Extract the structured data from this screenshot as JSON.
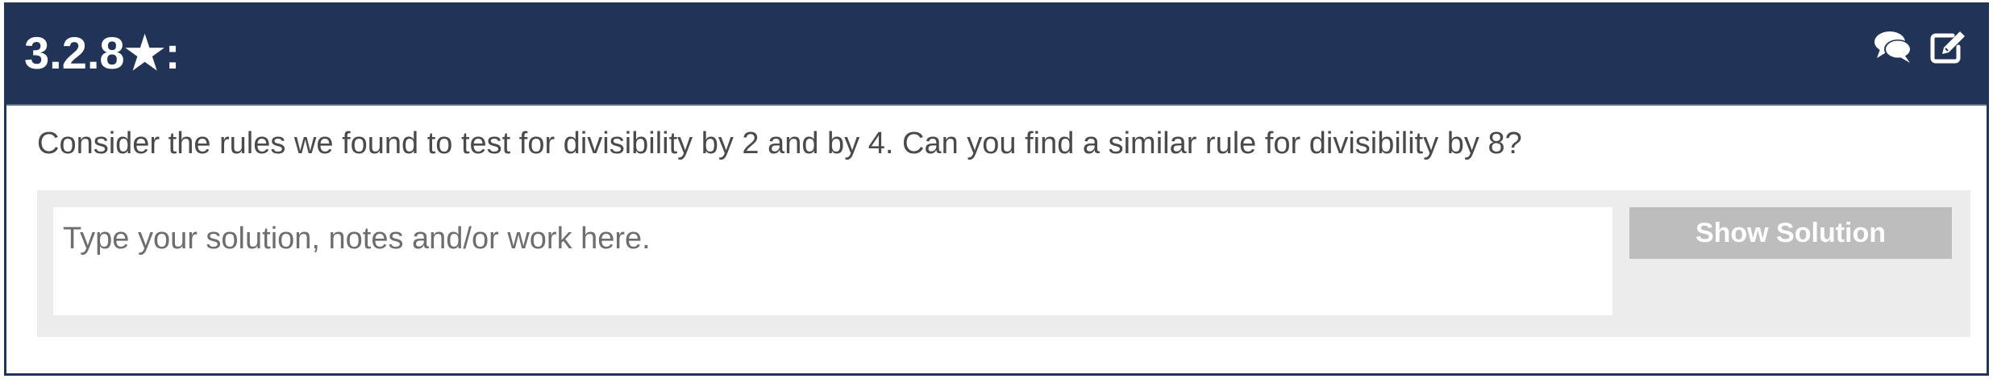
{
  "header": {
    "title": "3.2.8★:",
    "background_color": "#213457",
    "icons": {
      "comments": "comments-icon",
      "edit": "edit-icon"
    }
  },
  "problem": {
    "prompt": "Consider the rules we found to test for divisibility by 2 and by 4. Can you find a similar rule for divisibility by 8?"
  },
  "answer": {
    "placeholder": "Type your solution, notes and/or work here.",
    "value": "",
    "show_solution_label": "Show Solution",
    "button_color": "#bdbdbd",
    "panel_color": "#ececec"
  }
}
